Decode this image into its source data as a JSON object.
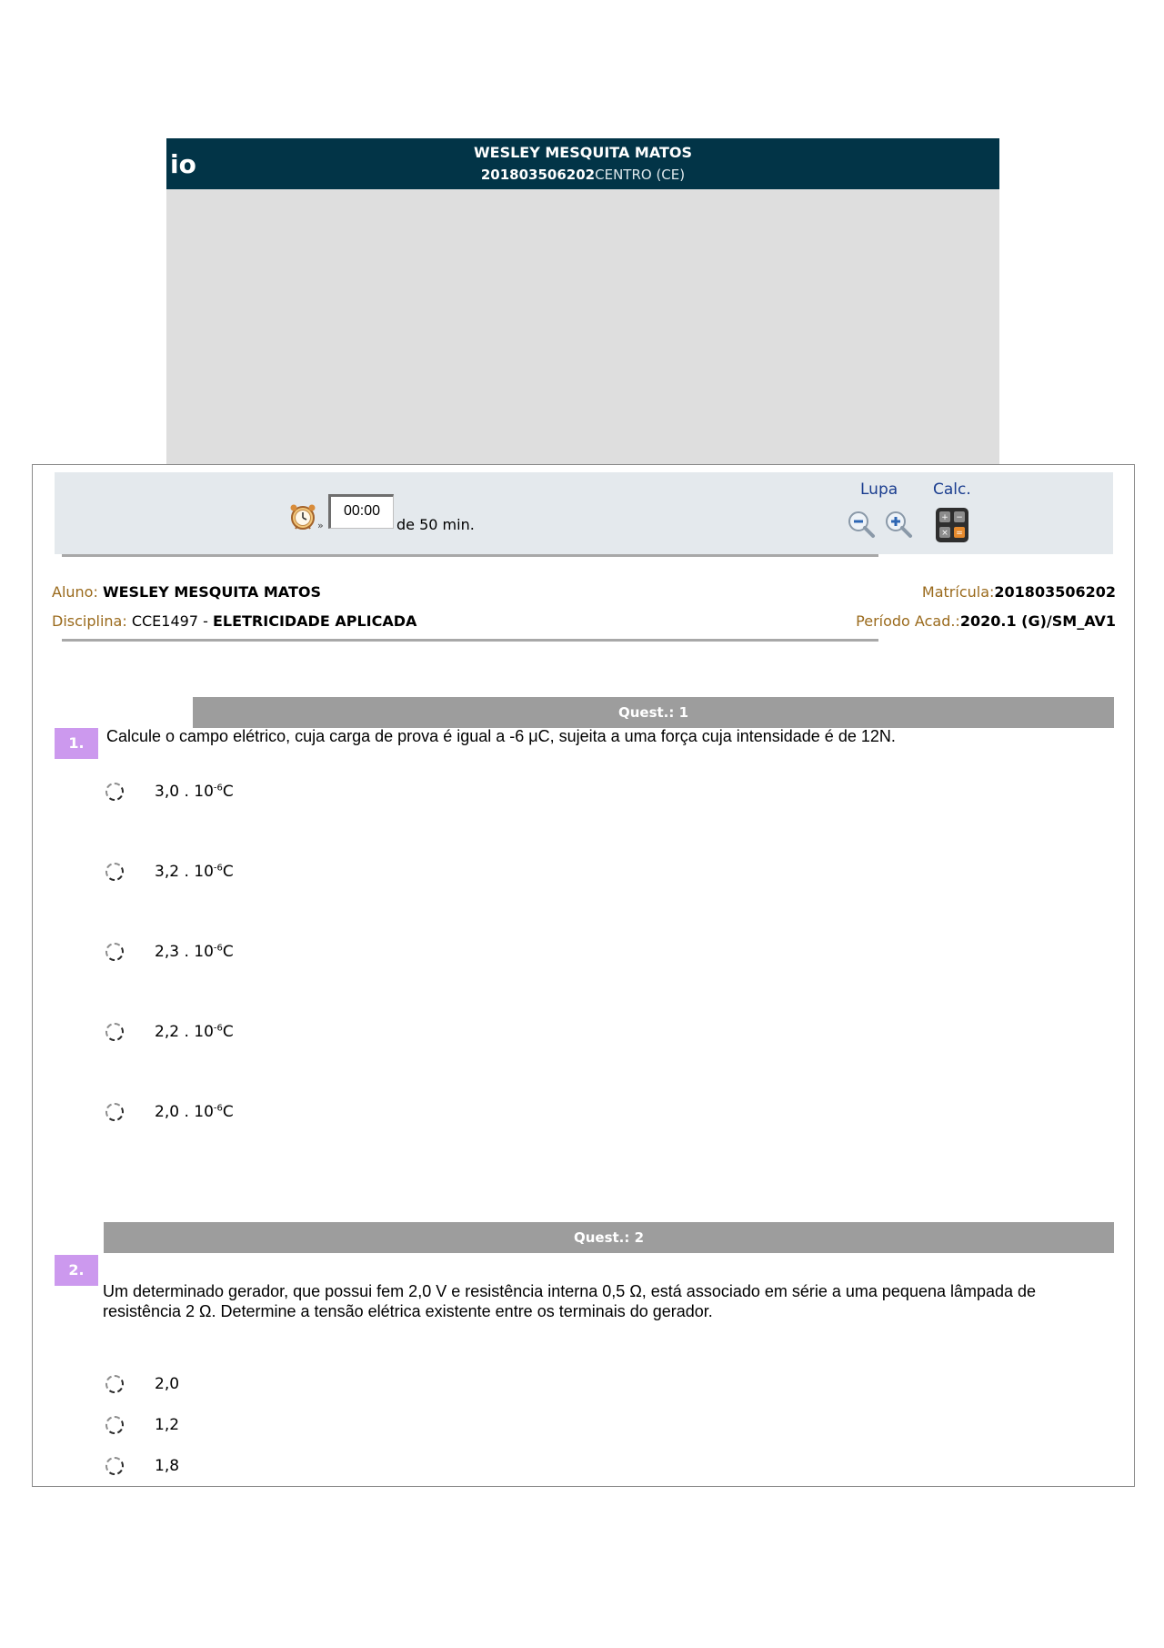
{
  "header": {
    "brand_fragment": "io",
    "student_name": "WESLEY MESQUITA MATOS",
    "student_id": "201803506202",
    "campus": "CENTRO (CE)"
  },
  "toolbar": {
    "timer_value": "00:00",
    "timer_arrows": "»",
    "timer_suffix": "de 50 min.",
    "lupa_label": "Lupa",
    "calc_label": "Calc."
  },
  "info": {
    "aluno_label": "Aluno:",
    "aluno_value": "WESLEY MESQUITA MATOS",
    "disciplina_label": "Disciplina:",
    "disciplina_code": "CCE1497 -",
    "disciplina_name": "ELETRICIDADE APLICADA",
    "matricula_label": "Matrícula:",
    "matricula_value": "201803506202",
    "periodo_label": "Período Acad.:",
    "periodo_value": "2020.1 (G)/SM_AV1"
  },
  "questions": [
    {
      "bar_label": "Quest.: 1",
      "number": "1.",
      "text": "Calcule o campo elétrico, cuja carga de prova é igual a -6 μC, sujeita a uma força cuja intensidade é de 12N.",
      "options": [
        {
          "base": "3,0 . 10",
          "exp": "-6",
          "unit": "C"
        },
        {
          "base": "3,2 . 10",
          "exp": "-6",
          "unit": "C"
        },
        {
          "base": "2,3 . 10",
          "exp": "-6",
          "unit": "C"
        },
        {
          "base": "2,2 . 10",
          "exp": "-6",
          "unit": "C"
        },
        {
          "base": "2,0 . 10",
          "exp": "-6",
          "unit": "C"
        }
      ]
    },
    {
      "bar_label": "Quest.: 2",
      "number": "2.",
      "text": "Um determinado gerador, que possui fem 2,0 V e resistência interna 0,5 Ω, está associado em série a uma pequena lâmpada de resistência 2 Ω. Determine a tensão elétrica existente entre os terminais do gerador.",
      "options": [
        {
          "label": "2,0"
        },
        {
          "label": "1,2"
        },
        {
          "label": "1,8"
        }
      ]
    }
  ]
}
